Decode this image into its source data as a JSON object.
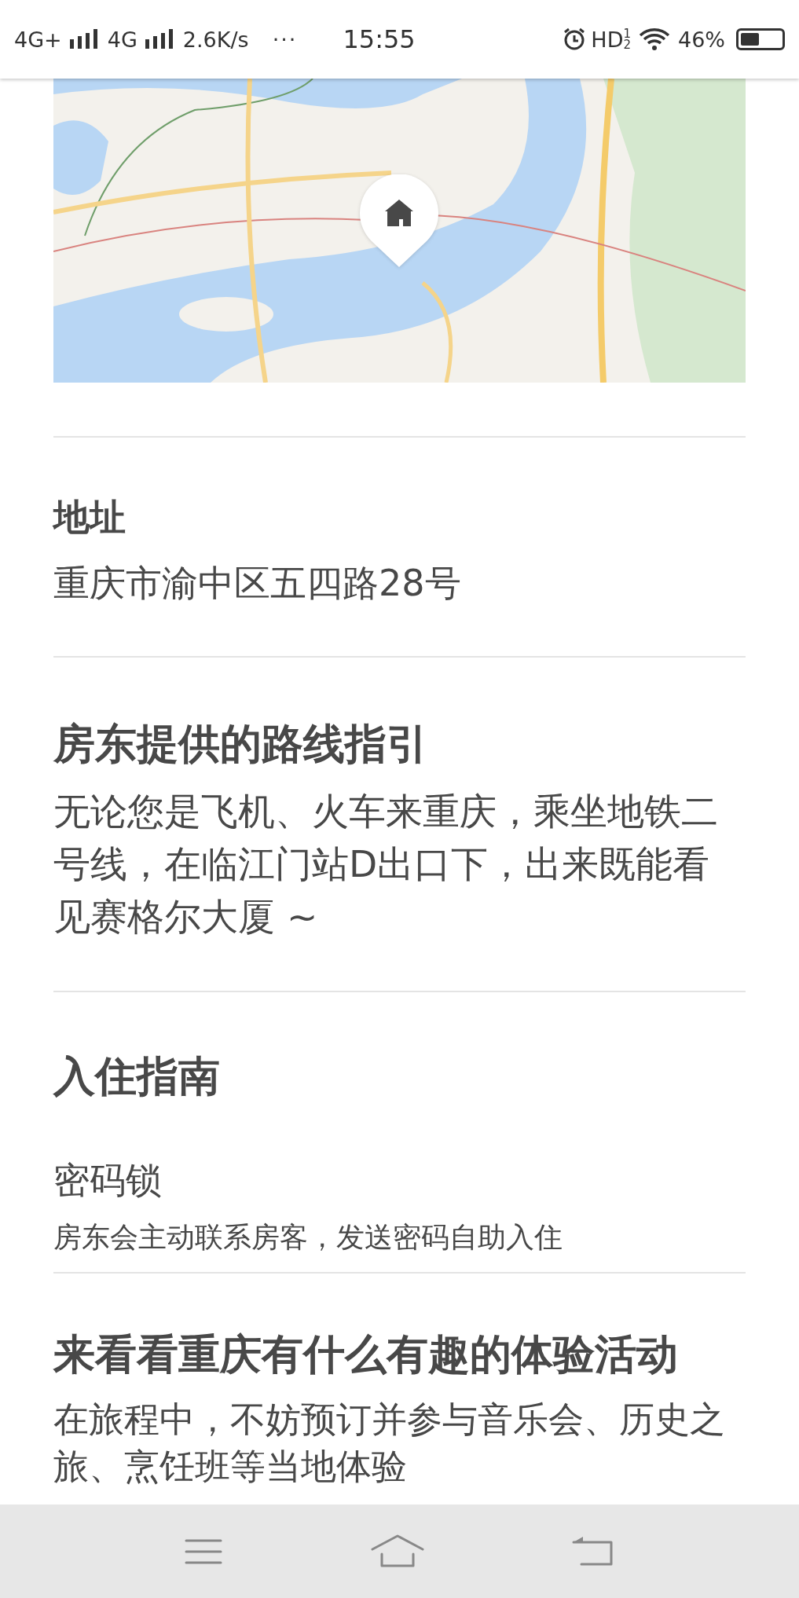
{
  "status_bar": {
    "network_1": "4G+",
    "network_2": "4G",
    "speed": "2.6K/s",
    "more": "···",
    "time": "15:55",
    "hd": "HD",
    "hd_marks": [
      "1",
      "2"
    ],
    "battery": "46%"
  },
  "sections": [
    {
      "kind": "info",
      "title": "地址",
      "text": "重庆市渝中区五四路28号"
    },
    {
      "kind": "para",
      "title": "房东提供的路线指引",
      "text": "无论您是飞机、火车来重庆，乘坐地铁二号线，在临江门站D出口下，出来既能看见赛格尔大厦 ~"
    },
    {
      "kind": "guide",
      "title": "入住指南",
      "item_title": "密码锁",
      "item_text": "房东会主动联系房客，发送密码自助入住"
    },
    {
      "kind": "promo",
      "title": "来看看重庆有什么有趣的体验活动",
      "text": "在旅程中，不妨预订并参与音乐会、历史之旅、烹饪班等当地体验"
    }
  ]
}
